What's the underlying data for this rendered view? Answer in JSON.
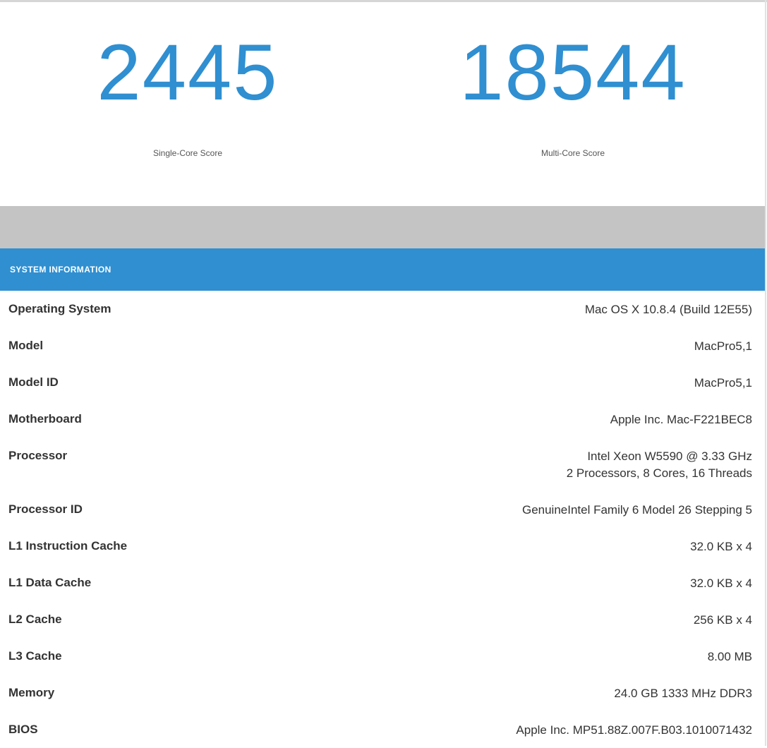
{
  "scores": {
    "single_core": {
      "value": "2445",
      "label": "Single-Core Score"
    },
    "multi_core": {
      "value": "18544",
      "label": "Multi-Core Score"
    }
  },
  "system_information": {
    "title": "SYSTEM INFORMATION",
    "rows": [
      {
        "key": "Operating System",
        "value": "Mac OS X 10.8.4 (Build 12E55)"
      },
      {
        "key": "Model",
        "value": "MacPro5,1"
      },
      {
        "key": "Model ID",
        "value": "MacPro5,1"
      },
      {
        "key": "Motherboard",
        "value": "Apple Inc. Mac-F221BEC8"
      },
      {
        "key": "Processor",
        "value": "Intel Xeon W5590 @ 3.33 GHz",
        "value_line2": "2 Processors, 8 Cores, 16 Threads"
      },
      {
        "key": "Processor ID",
        "value": "GenuineIntel Family 6 Model 26 Stepping 5"
      },
      {
        "key": "L1 Instruction Cache",
        "value": "32.0 KB x 4"
      },
      {
        "key": "L1 Data Cache",
        "value": "32.0 KB x 4"
      },
      {
        "key": "L2 Cache",
        "value": "256 KB x 4"
      },
      {
        "key": "L3 Cache",
        "value": "8.00 MB"
      },
      {
        "key": "Memory",
        "value": "24.0 GB 1333 MHz DDR3"
      },
      {
        "key": "BIOS",
        "value": "Apple Inc. MP51.88Z.007F.B03.1010071432"
      }
    ]
  },
  "colors": {
    "accent": "#2f8fd1",
    "band": "#c4c4c4",
    "text": "#333333"
  }
}
